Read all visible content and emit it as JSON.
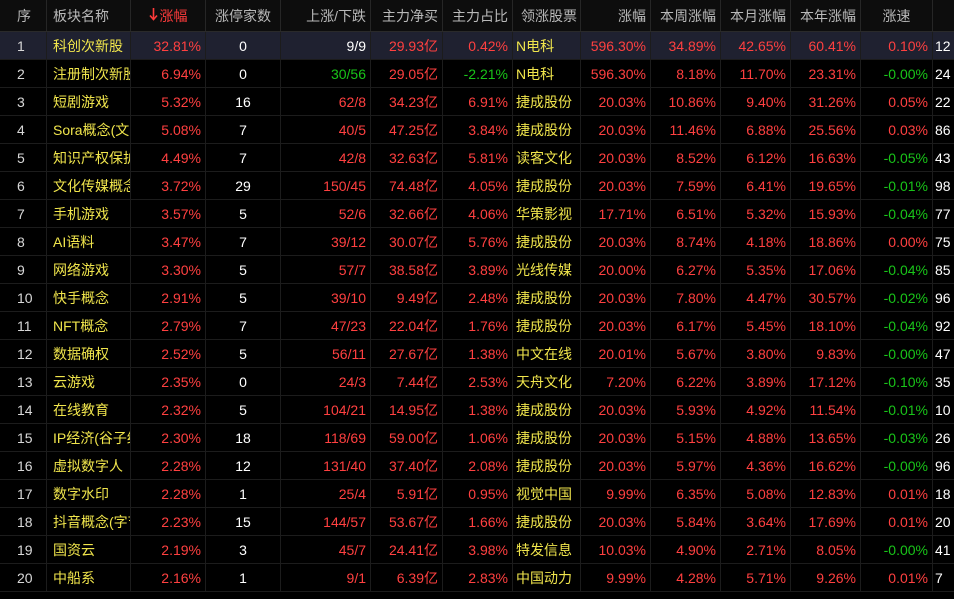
{
  "colors": {
    "up": "#ff4040",
    "down": "#19c419",
    "name": "#f0e54c",
    "background": "#000000",
    "selected": "#1f2130"
  },
  "header": {
    "seq": "序",
    "name": "板块名称",
    "sort_icon": "arrow-down-icon",
    "pct": "涨幅",
    "limit_up": "涨停家数",
    "up_down": "上涨/下跌",
    "net_inflow": "主力净买",
    "ratio": "主力占比",
    "leader": "领涨股票",
    "leader_pct": "涨幅",
    "week": "本周涨幅",
    "month": "本月涨幅",
    "year": "本年涨幅",
    "speed": "涨速"
  },
  "rows": [
    {
      "seq": "1",
      "name": "科创次新股",
      "pct": "32.81%",
      "limit_up": "0",
      "up_down": "9/9",
      "ud_dir": "neutral",
      "net": "29.93亿",
      "ratio": "0.42%",
      "ratio_dir": "up",
      "leader": "N电科",
      "leader_pct": "596.30%",
      "week": "34.89%",
      "month": "42.65%",
      "year": "60.41%",
      "speed": "0.10%",
      "speed_dir": "up",
      "extra": "12"
    },
    {
      "seq": "2",
      "name": "注册制次新股",
      "pct": "6.94%",
      "limit_up": "0",
      "up_down": "30/56",
      "ud_dir": "down",
      "net": "29.05亿",
      "ratio": "-2.21%",
      "ratio_dir": "down",
      "leader": "N电科",
      "leader_pct": "596.30%",
      "week": "8.18%",
      "month": "11.70%",
      "year": "23.31%",
      "speed": "-0.00%",
      "speed_dir": "down",
      "extra": "24"
    },
    {
      "seq": "3",
      "name": "短剧游戏",
      "pct": "5.32%",
      "limit_up": "16",
      "up_down": "62/8",
      "ud_dir": "up",
      "net": "34.23亿",
      "ratio": "6.91%",
      "ratio_dir": "up",
      "leader": "捷成股份",
      "leader_pct": "20.03%",
      "week": "10.86%",
      "month": "9.40%",
      "year": "31.26%",
      "speed": "0.05%",
      "speed_dir": "up",
      "extra": "22"
    },
    {
      "seq": "4",
      "name": "Sora概念(文生视频)",
      "pct": "5.08%",
      "limit_up": "7",
      "up_down": "40/5",
      "ud_dir": "up",
      "net": "47.25亿",
      "ratio": "3.84%",
      "ratio_dir": "up",
      "leader": "捷成股份",
      "leader_pct": "20.03%",
      "week": "11.46%",
      "month": "6.88%",
      "year": "25.56%",
      "speed": "0.03%",
      "speed_dir": "up",
      "extra": "86"
    },
    {
      "seq": "5",
      "name": "知识产权保护",
      "pct": "4.49%",
      "limit_up": "7",
      "up_down": "42/8",
      "ud_dir": "up",
      "net": "32.63亿",
      "ratio": "5.81%",
      "ratio_dir": "up",
      "leader": "读客文化",
      "leader_pct": "20.03%",
      "week": "8.52%",
      "month": "6.12%",
      "year": "16.63%",
      "speed": "-0.05%",
      "speed_dir": "down",
      "extra": "43"
    },
    {
      "seq": "6",
      "name": "文化传媒概念",
      "pct": "3.72%",
      "limit_up": "29",
      "up_down": "150/45",
      "ud_dir": "up",
      "net": "74.48亿",
      "ratio": "4.05%",
      "ratio_dir": "up",
      "leader": "捷成股份",
      "leader_pct": "20.03%",
      "week": "7.59%",
      "month": "6.41%",
      "year": "19.65%",
      "speed": "-0.01%",
      "speed_dir": "down",
      "extra": "98"
    },
    {
      "seq": "7",
      "name": "手机游戏",
      "pct": "3.57%",
      "limit_up": "5",
      "up_down": "52/6",
      "ud_dir": "up",
      "net": "32.66亿",
      "ratio": "4.06%",
      "ratio_dir": "up",
      "leader": "华策影视",
      "leader_pct": "17.71%",
      "week": "6.51%",
      "month": "5.32%",
      "year": "15.93%",
      "speed": "-0.04%",
      "speed_dir": "down",
      "extra": "77"
    },
    {
      "seq": "8",
      "name": "AI语料",
      "pct": "3.47%",
      "limit_up": "7",
      "up_down": "39/12",
      "ud_dir": "up",
      "net": "30.07亿",
      "ratio": "5.76%",
      "ratio_dir": "up",
      "leader": "捷成股份",
      "leader_pct": "20.03%",
      "week": "8.74%",
      "month": "4.18%",
      "year": "18.86%",
      "speed": "0.00%",
      "speed_dir": "up",
      "extra": "75"
    },
    {
      "seq": "9",
      "name": "网络游戏",
      "pct": "3.30%",
      "limit_up": "5",
      "up_down": "57/7",
      "ud_dir": "up",
      "net": "38.58亿",
      "ratio": "3.89%",
      "ratio_dir": "up",
      "leader": "光线传媒",
      "leader_pct": "20.00%",
      "week": "6.27%",
      "month": "5.35%",
      "year": "17.06%",
      "speed": "-0.04%",
      "speed_dir": "down",
      "extra": "85"
    },
    {
      "seq": "10",
      "name": "快手概念",
      "pct": "2.91%",
      "limit_up": "5",
      "up_down": "39/10",
      "ud_dir": "up",
      "net": "9.49亿",
      "ratio": "2.48%",
      "ratio_dir": "up",
      "leader": "捷成股份",
      "leader_pct": "20.03%",
      "week": "7.80%",
      "month": "4.47%",
      "year": "30.57%",
      "speed": "-0.02%",
      "speed_dir": "down",
      "extra": "96"
    },
    {
      "seq": "11",
      "name": "NFT概念",
      "pct": "2.79%",
      "limit_up": "7",
      "up_down": "47/23",
      "ud_dir": "up",
      "net": "22.04亿",
      "ratio": "1.76%",
      "ratio_dir": "up",
      "leader": "捷成股份",
      "leader_pct": "20.03%",
      "week": "6.17%",
      "month": "5.45%",
      "year": "18.10%",
      "speed": "-0.04%",
      "speed_dir": "down",
      "extra": "92"
    },
    {
      "seq": "12",
      "name": "数据确权",
      "pct": "2.52%",
      "limit_up": "5",
      "up_down": "56/11",
      "ud_dir": "up",
      "net": "27.67亿",
      "ratio": "1.38%",
      "ratio_dir": "up",
      "leader": "中文在线",
      "leader_pct": "20.01%",
      "week": "5.67%",
      "month": "3.80%",
      "year": "9.83%",
      "speed": "-0.00%",
      "speed_dir": "down",
      "extra": "47"
    },
    {
      "seq": "13",
      "name": "云游戏",
      "pct": "2.35%",
      "limit_up": "0",
      "up_down": "24/3",
      "ud_dir": "up",
      "net": "7.44亿",
      "ratio": "2.53%",
      "ratio_dir": "up",
      "leader": "天舟文化",
      "leader_pct": "7.20%",
      "week": "6.22%",
      "month": "3.89%",
      "year": "17.12%",
      "speed": "-0.10%",
      "speed_dir": "down",
      "extra": "35"
    },
    {
      "seq": "14",
      "name": "在线教育",
      "pct": "2.32%",
      "limit_up": "5",
      "up_down": "104/21",
      "ud_dir": "up",
      "net": "14.95亿",
      "ratio": "1.38%",
      "ratio_dir": "up",
      "leader": "捷成股份",
      "leader_pct": "20.03%",
      "week": "5.93%",
      "month": "4.92%",
      "year": "11.54%",
      "speed": "-0.01%",
      "speed_dir": "down",
      "extra": "10"
    },
    {
      "seq": "15",
      "name": "IP经济(谷子经济)",
      "pct": "2.30%",
      "limit_up": "18",
      "up_down": "118/69",
      "ud_dir": "up",
      "net": "59.00亿",
      "ratio": "1.06%",
      "ratio_dir": "up",
      "leader": "捷成股份",
      "leader_pct": "20.03%",
      "week": "5.15%",
      "month": "4.88%",
      "year": "13.65%",
      "speed": "-0.03%",
      "speed_dir": "down",
      "extra": "26"
    },
    {
      "seq": "16",
      "name": "虚拟数字人",
      "pct": "2.28%",
      "limit_up": "12",
      "up_down": "131/40",
      "ud_dir": "up",
      "net": "37.40亿",
      "ratio": "2.08%",
      "ratio_dir": "up",
      "leader": "捷成股份",
      "leader_pct": "20.03%",
      "week": "5.97%",
      "month": "4.36%",
      "year": "16.62%",
      "speed": "-0.00%",
      "speed_dir": "down",
      "extra": "96"
    },
    {
      "seq": "17",
      "name": "数字水印",
      "pct": "2.28%",
      "limit_up": "1",
      "up_down": "25/4",
      "ud_dir": "up",
      "net": "5.91亿",
      "ratio": "0.95%",
      "ratio_dir": "up",
      "leader": "视觉中国",
      "leader_pct": "9.99%",
      "week": "6.35%",
      "month": "5.08%",
      "year": "12.83%",
      "speed": "0.01%",
      "speed_dir": "up",
      "extra": "18"
    },
    {
      "seq": "18",
      "name": "抖音概念(字节概念)",
      "pct": "2.23%",
      "limit_up": "15",
      "up_down": "144/57",
      "ud_dir": "up",
      "net": "53.67亿",
      "ratio": "1.66%",
      "ratio_dir": "up",
      "leader": "捷成股份",
      "leader_pct": "20.03%",
      "week": "5.84%",
      "month": "3.64%",
      "year": "17.69%",
      "speed": "0.01%",
      "speed_dir": "up",
      "extra": "20"
    },
    {
      "seq": "19",
      "name": "国资云",
      "pct": "2.19%",
      "limit_up": "3",
      "up_down": "45/7",
      "ud_dir": "up",
      "net": "24.41亿",
      "ratio": "3.98%",
      "ratio_dir": "up",
      "leader": "特发信息",
      "leader_pct": "10.03%",
      "week": "4.90%",
      "month": "2.71%",
      "year": "8.05%",
      "speed": "-0.00%",
      "speed_dir": "down",
      "extra": "41"
    },
    {
      "seq": "20",
      "name": "中船系",
      "pct": "2.16%",
      "limit_up": "1",
      "up_down": "9/1",
      "ud_dir": "up",
      "net": "6.39亿",
      "ratio": "2.83%",
      "ratio_dir": "up",
      "leader": "中国动力",
      "leader_pct": "9.99%",
      "week": "4.28%",
      "month": "5.71%",
      "year": "9.26%",
      "speed": "0.01%",
      "speed_dir": "up",
      "extra": "7"
    }
  ]
}
